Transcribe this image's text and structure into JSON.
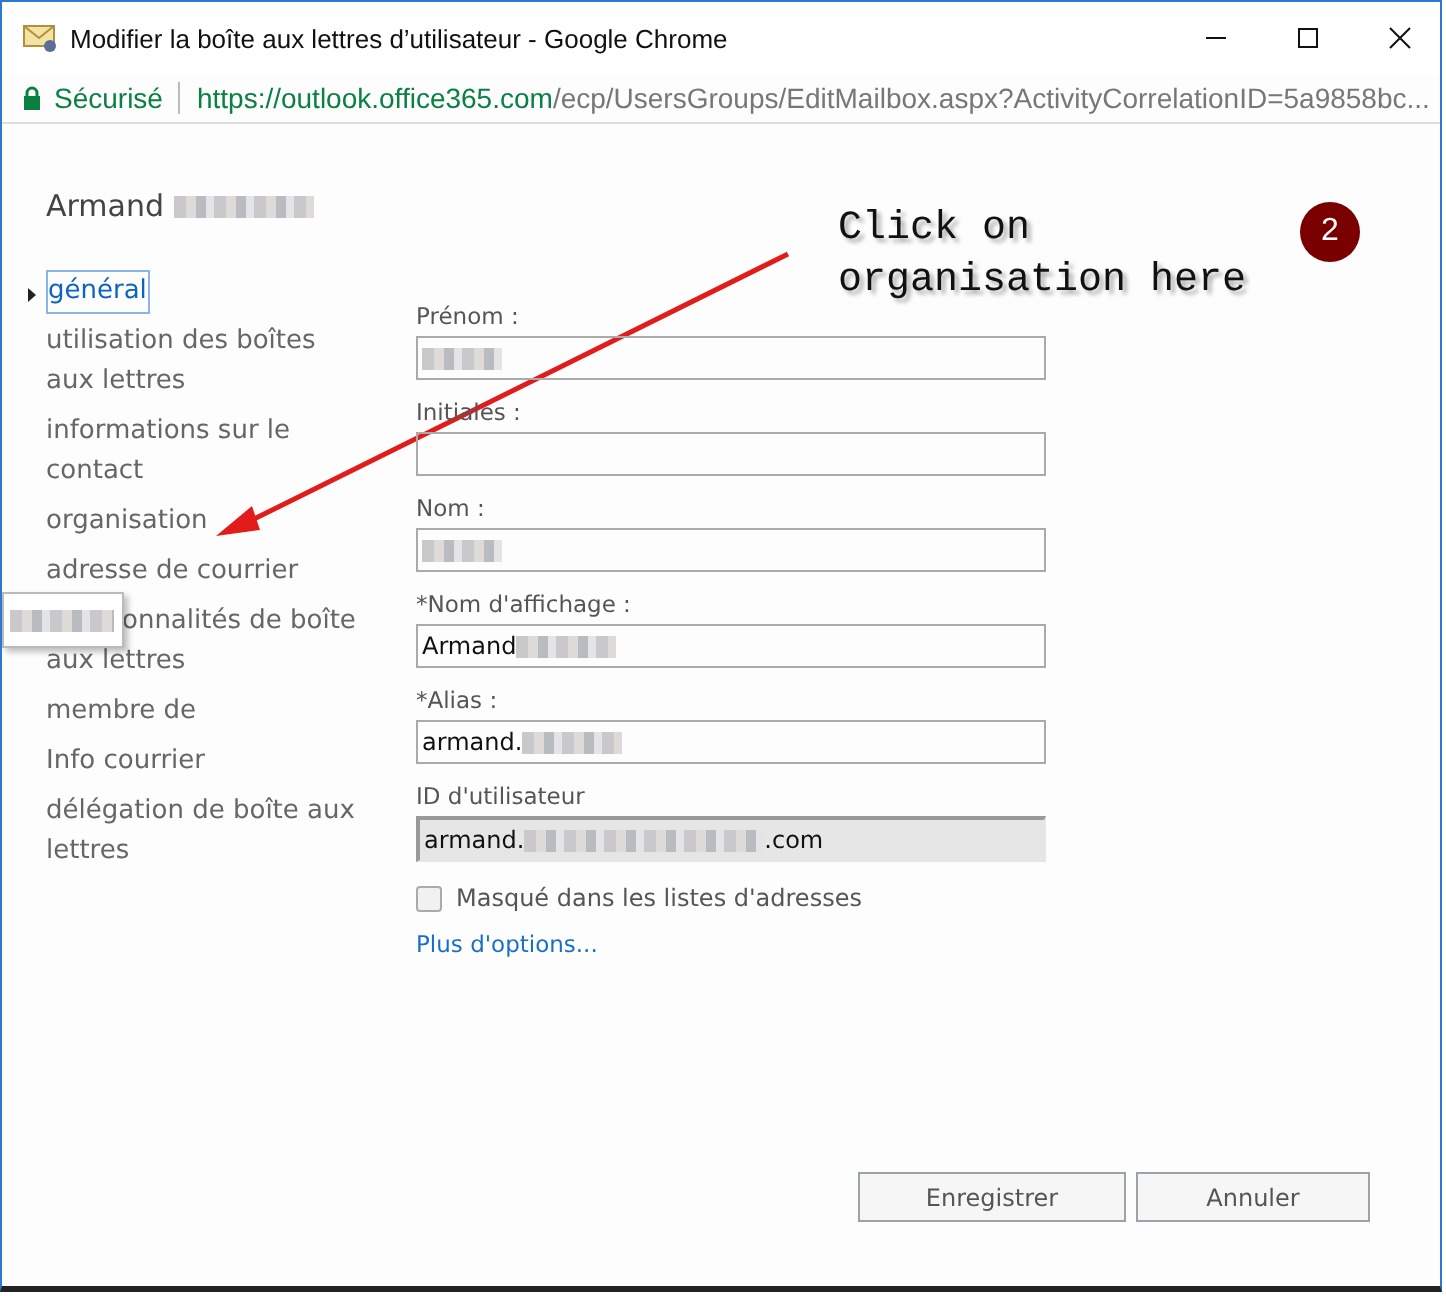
{
  "window": {
    "title": "Modifier la boîte aux lettres d’utilisateur - Google Chrome"
  },
  "address_bar": {
    "security": "Sécurisé",
    "url_host": "https://outlook.office365.com",
    "url_path": "/ecp/UsersGroups/EditMailbox.aspx?ActivityCorrelationID=5a9858bc..."
  },
  "user": {
    "name": "Armand",
    "redacted": true
  },
  "sidebar": {
    "items": [
      {
        "label": "général",
        "selected": true
      },
      {
        "label": "utilisation des boîtes aux lettres",
        "selected": false
      },
      {
        "label": "informations sur le contact",
        "selected": false
      },
      {
        "label": "organisation",
        "selected": false
      },
      {
        "label": "adresse de courrier",
        "selected": false
      },
      {
        "label": "onnalités de boîte aux lettres",
        "selected": false,
        "covered": true
      },
      {
        "label": "membre de",
        "selected": false
      },
      {
        "label": "Info courrier",
        "selected": false
      },
      {
        "label": "délégation de boîte aux lettres",
        "selected": false
      }
    ]
  },
  "form": {
    "fields": [
      {
        "label": "Prénom :",
        "redacted": true,
        "disabled": false
      },
      {
        "label": "Initiales :",
        "redacted": false,
        "disabled": false
      },
      {
        "label": "Nom :",
        "redacted": true,
        "disabled": false
      },
      {
        "label": "*Nom d'affichage :",
        "value": "Armand",
        "redacted": true,
        "disabled": false
      },
      {
        "label": "*Alias :",
        "value": "armand.",
        "redacted": true,
        "disabled": false
      },
      {
        "label": "ID d'utilisateur",
        "value": "armand.",
        "redacted": true,
        "suffix": ".com",
        "disabled": true
      }
    ],
    "checkbox": {
      "label": "Masqué dans les listes d'adresses",
      "checked": false
    },
    "more_link": "Plus d'options..."
  },
  "buttons": [
    "Enregistrer",
    "Annuler"
  ],
  "annotation": {
    "text": "Click on\norganisation here",
    "badge": "2"
  }
}
